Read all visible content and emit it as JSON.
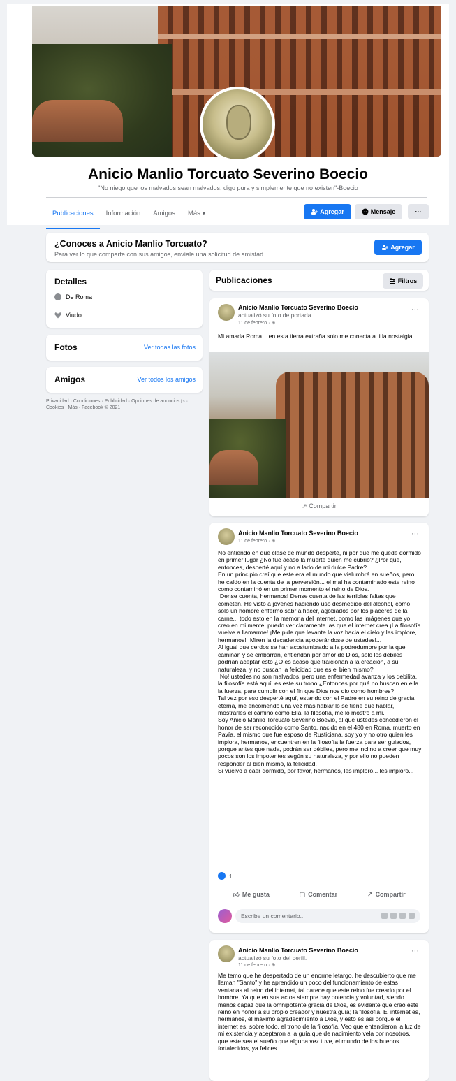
{
  "profile": {
    "name": "Anicio Manlio Torcuato Severino Boecio",
    "bio": "\"No niego que los malvados sean malvados; digo pura y simplemente que no existen\"-Boecio"
  },
  "tabs": [
    {
      "label": "Publicaciones",
      "active": true
    },
    {
      "label": "Información",
      "active": false
    },
    {
      "label": "Amigos",
      "active": false
    },
    {
      "label": "Más ▾",
      "active": false
    }
  ],
  "header_buttons": {
    "add": "Agregar",
    "message": "Mensaje",
    "more": "···"
  },
  "know_card": {
    "title": "¿Conoces a Anicio Manlio Torcuato?",
    "subtitle": "Para ver lo que comparte con sus amigos, envíale una solicitud de amistad.",
    "button": "Agregar"
  },
  "details": {
    "title": "Detalles",
    "location": "De Roma",
    "relationship": "Viudo"
  },
  "photos": {
    "title": "Fotos",
    "link": "Ver todas las fotos"
  },
  "friends": {
    "title": "Amigos",
    "link": "Ver todos los amigos"
  },
  "footer": "Privacidad · Condiciones · Publicidad · Opciones de anuncios ▷ · Cookies · Más · Facebook © 2021",
  "publications": {
    "title": "Publicaciones",
    "filter": "Filtros"
  },
  "posts": [
    {
      "author": "Anicio Manlio Torcuato Severino Boecio",
      "action": "actualizó su foto de portada.",
      "date": "11 de febrero · ⊕",
      "text": "Mi amada Roma... en esta tierra extraña solo me conecta a ti la nostalgia.",
      "share": "Compartir"
    },
    {
      "author": "Anicio Manlio Torcuato Severino Boecio",
      "date": "11 de febrero · ⊕",
      "text": "No entiendo en qué clase de mundo desperté, ni por qué me quedé dormido en primer lugar ¿No fue acaso la muerte quien me cubrió? ¿Por qué, entonces, desperté aquí y no a lado de mi dulce Padre?\nEn un principio creí que este era el mundo que vislumbré en sueños, pero he caído en la cuenta de la perversión... el mal ha contaminado este reino como contaminó en un primer momento el reino de Dios.\n¡Dense cuenta, hermanos! Dense cuenta de las terribles faltas que cometen. He visto a jóvenes haciendo uso desmedido del alcohol, como solo un hombre enfermo sabría hacer, agobiados por los placeres de la carne... todo esto en la memoria del internet, como las imágenes que yo creo en mi mente, puedo ver claramente las que el internet crea ¡La filosofía vuelve a llamarme! ¡Me pide que levante la voz hacia el cielo y les implore, hermanos! ¡Miren la decadencia apoderándose de ustedes!...\nAl igual que cerdos se han acostumbrado a la podredumbre por la que caminan y se embarran, entiendan por amor de Dios, solo los débiles podrían aceptar esto ¿O es acaso que traicionan a la creación, a su naturaleza, y no buscan la felicidad que es el bien mismo?\n¡No! ustedes no son malvados, pero una enfermedad avanza y los debilita, la filosofía está aquí, es este su trono ¿Entonces por qué no buscan en ella la fuerza, para cumplir con el fin que Dios nos dio como hombres?\nTal vez por eso desperté aquí, estando con el Padre en su reino de gracia eterna, me encomendó una vez más hablar lo se tiene que hablar, mostrarles el camino como Ella, la filosofía, me lo mostró a mí.\nSoy Anicio Manlio Torcuato Severino Boevio, al que ustedes concedieron el honor de ser reconocido como Santo, nacido en el 480 en Roma, muerto en Pavía, el mismo que fue esposo de Rusticiana, soy yo y no otro quien les implora, hermanos, encuentren en la filosofía la fuerza para ser guiados, porque antes que nada, podrán ser débiles, pero me inclino a creer que muy pocos son los impotentes según su naturaleza, y por ello no pueden responder al bien mismo, la felicidad.\nSi vuelvo a caer dormido, por favor, hermanos, les imploro... les imploro...",
      "likes": "1",
      "like_label": "Me gusta",
      "comment_label": "Comentar",
      "share_label": "Compartir",
      "comment_placeholder": "Escribe un comentario..."
    },
    {
      "author": "Anicio Manlio Torcuato Severino Boecio",
      "action": "actualizó su foto del perfil.",
      "date": "11 de febrero · ⊕",
      "text": "Me temo que he despertado de un enorme letargo, he descubierto que me llaman \"Santo\" y he aprendido un poco del funcionamiento de estas ventanas al reino del internet, tal parece que este reino fue creado por el hombre. Ya que en sus actos siempre hay potencia y voluntad, siendo menos capaz que la omnipotente gracia de Dios, es evidente que creó este reino en honor a su propio creador y nuestra guía; la filosofía. El internet es, hermanos, el máximo agradecimiento a Dios, y esto es así porque el internet es, sobre todo, el trono de la filosofía. Veo que entendieron la luz de mi existencia y aceptaron a la guía que de nacimiento vela por nosotros, que este sea el sueño que alguna vez tuve, el mundo de los buenos fortalecidos, ya felices."
    }
  ]
}
